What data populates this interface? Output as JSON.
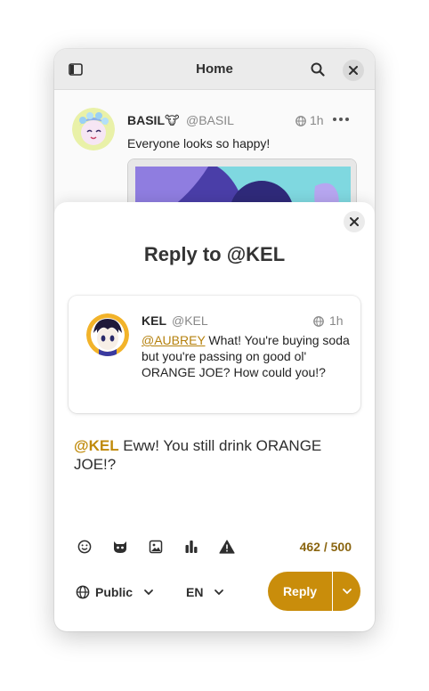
{
  "header": {
    "title": "Home",
    "sidebar_icon": "sidebar-toggle-icon",
    "search_icon": "search-icon",
    "close_icon": "close-icon"
  },
  "post": {
    "display_name": "BASIL🐮",
    "handle": "@BASIL",
    "time": "1h",
    "text": "Everyone looks so happy!"
  },
  "dialog": {
    "title": "Reply to @KEL",
    "replying_to": {
      "display_name": "KEL",
      "handle": "@KEL",
      "time": "1h",
      "mention": "@AUBREY",
      "text": " What! You're buying soda but you're passing on good ol' ORANGE JOE? How could you!?"
    },
    "compose": {
      "mention": "@KEL",
      "text": " Eww! You still drink ORANGE JOE!?"
    },
    "tools": [
      "emoji-icon",
      "custom-emoji-icon",
      "image-icon",
      "poll-icon",
      "content-warning-icon"
    ],
    "char_counter": "462 / 500",
    "visibility_label": "Public",
    "language_label": "EN",
    "reply_label": "Reply"
  },
  "colors": {
    "accent": "#c98d0b",
    "mention": "#c08a0a",
    "counter": "#8a6510"
  }
}
